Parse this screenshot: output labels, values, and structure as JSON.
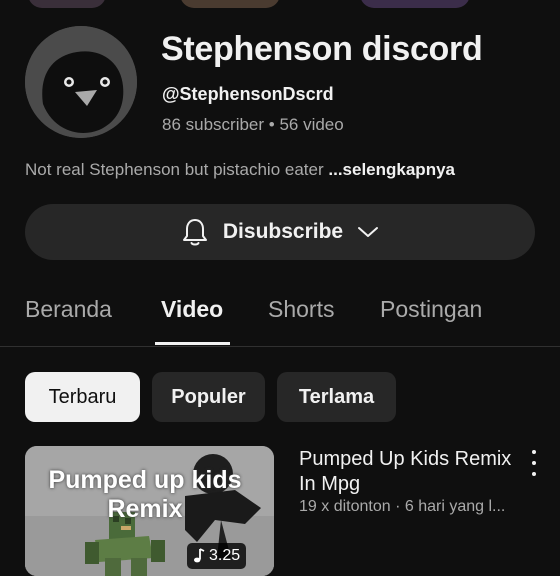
{
  "channel": {
    "name": "Stephenson discord",
    "handle": "@StephensonDscrd",
    "stats": "86 subscriber • 56 video",
    "description": "Not real Stephenson but pistachio eater ",
    "more_link": "...selengkapnya",
    "avatar_icon": "bird-avatar-icon"
  },
  "subscribe": {
    "label": "Disubscribe",
    "bell_icon": "bell-icon",
    "chevron_icon": "chevron-down-icon"
  },
  "tabs": [
    {
      "label": "Beranda",
      "active": false
    },
    {
      "label": "Video",
      "active": true
    },
    {
      "label": "Shorts",
      "active": false
    },
    {
      "label": "Postingan",
      "active": false
    }
  ],
  "filters": [
    {
      "label": "Terbaru",
      "active": true
    },
    {
      "label": "Populer",
      "active": false
    },
    {
      "label": "Terlama",
      "active": false
    }
  ],
  "videos": [
    {
      "title": "Pumped Up Kids Remix In Mpg",
      "meta": "19 x ditonton · 6 hari yang l...",
      "thumbnail_text": "Pumped up kids Remix",
      "duration": "3.25"
    }
  ],
  "colors": {
    "background": "#0f0f0f",
    "surface": "#272727",
    "text": "#f1f1f1",
    "secondary_text": "#aaaaaa"
  }
}
